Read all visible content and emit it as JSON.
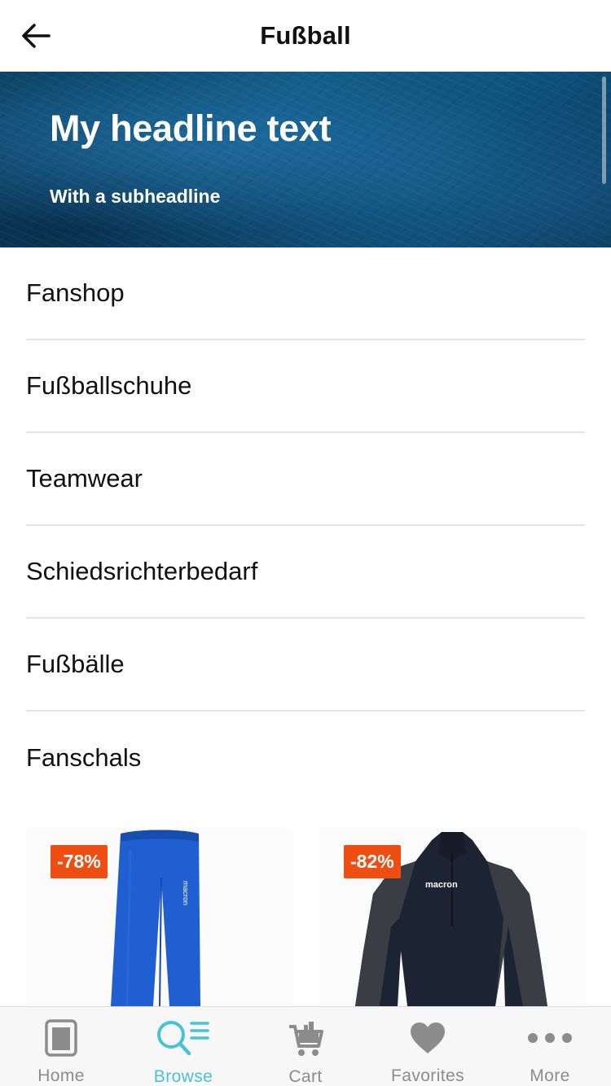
{
  "header": {
    "title": "Fußball"
  },
  "banner": {
    "headline": "My headline text",
    "subheadline": "With a subheadline"
  },
  "categories": [
    {
      "label": "Fanshop"
    },
    {
      "label": "Fußballschuhe"
    },
    {
      "label": "Teamwear"
    },
    {
      "label": "Schiedsrichterbedarf"
    },
    {
      "label": "Fußbälle"
    },
    {
      "label": "Fanschals"
    }
  ],
  "products": [
    {
      "discount": "-78%",
      "image": "blue-training-pants",
      "brand": "macron"
    },
    {
      "discount": "-82%",
      "image": "navy-training-top",
      "brand": "macron"
    }
  ],
  "tabbar": {
    "items": [
      {
        "label": "Home",
        "icon": "home-icon"
      },
      {
        "label": "Browse",
        "icon": "browse-icon",
        "active": true
      },
      {
        "label": "Cart",
        "icon": "cart-icon"
      },
      {
        "label": "Favorites",
        "icon": "heart-icon"
      },
      {
        "label": "More",
        "icon": "more-icon"
      }
    ]
  },
  "colors": {
    "accent": "#49c2d7",
    "badge": "#ef4e13",
    "inactive_tab": "#8c8c8c"
  }
}
